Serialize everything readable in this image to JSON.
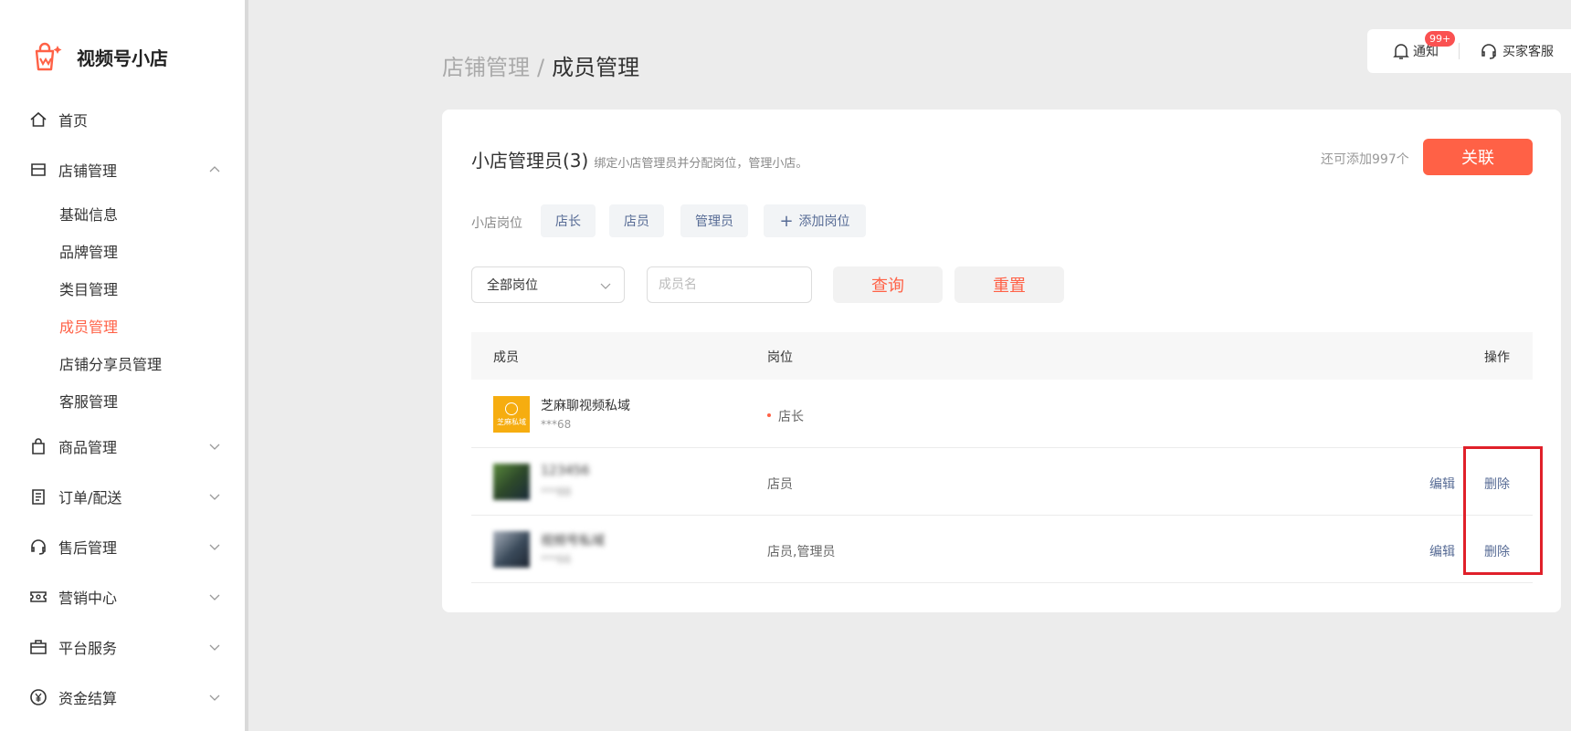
{
  "brand": {
    "name": "视频号小店"
  },
  "sidebar": {
    "items": [
      {
        "label": "首页",
        "icon": "home-icon"
      },
      {
        "label": "店铺管理",
        "icon": "store-icon",
        "expanded": true,
        "children": [
          {
            "label": "基础信息"
          },
          {
            "label": "品牌管理"
          },
          {
            "label": "类目管理"
          },
          {
            "label": "成员管理",
            "active": true
          },
          {
            "label": "店铺分享员管理"
          },
          {
            "label": "客服管理"
          }
        ]
      },
      {
        "label": "商品管理",
        "icon": "shopping-bag-icon"
      },
      {
        "label": "订单/配送",
        "icon": "order-list-icon"
      },
      {
        "label": "售后管理",
        "icon": "headset-icon"
      },
      {
        "label": "营销中心",
        "icon": "ticket-icon"
      },
      {
        "label": "平台服务",
        "icon": "briefcase-icon"
      },
      {
        "label": "资金结算",
        "icon": "yuan-coin-icon"
      }
    ]
  },
  "topbar": {
    "notice_label": "通知",
    "notice_badge": "99+",
    "service_label": "买家客服"
  },
  "breadcrumb": {
    "parent": "店铺管理",
    "separator": "/",
    "current": "成员管理"
  },
  "card": {
    "title": "小店管理员(3)",
    "desc": "绑定小店管理员并分配岗位，管理小店。",
    "remain": "还可添加997个",
    "link_button": "关联",
    "roles_label": "小店岗位",
    "roles": [
      "店长",
      "店员",
      "管理员"
    ],
    "add_role": "添加岗位",
    "filter": {
      "select_value": "全部岗位",
      "name_placeholder": "成员名",
      "query_button": "查询",
      "reset_button": "重置"
    },
    "table": {
      "headers": {
        "member": "成员",
        "role": "岗位",
        "action": "操作"
      },
      "rows": [
        {
          "name": "芝麻聊视频私域",
          "phone": "***68",
          "role": "店长",
          "avatar_text": "芝麻私域",
          "actions": []
        },
        {
          "name": "123456",
          "phone": "***88",
          "role": "店员",
          "actions": [
            "编辑",
            "删除"
          ]
        },
        {
          "name": "视频号私域",
          "phone": "***66",
          "role": "店员,管理员",
          "actions": [
            "编辑",
            "删除"
          ]
        }
      ]
    }
  },
  "colors": {
    "accent": "#ff6146",
    "link": "#576b95",
    "highlight": "#e0202a"
  }
}
